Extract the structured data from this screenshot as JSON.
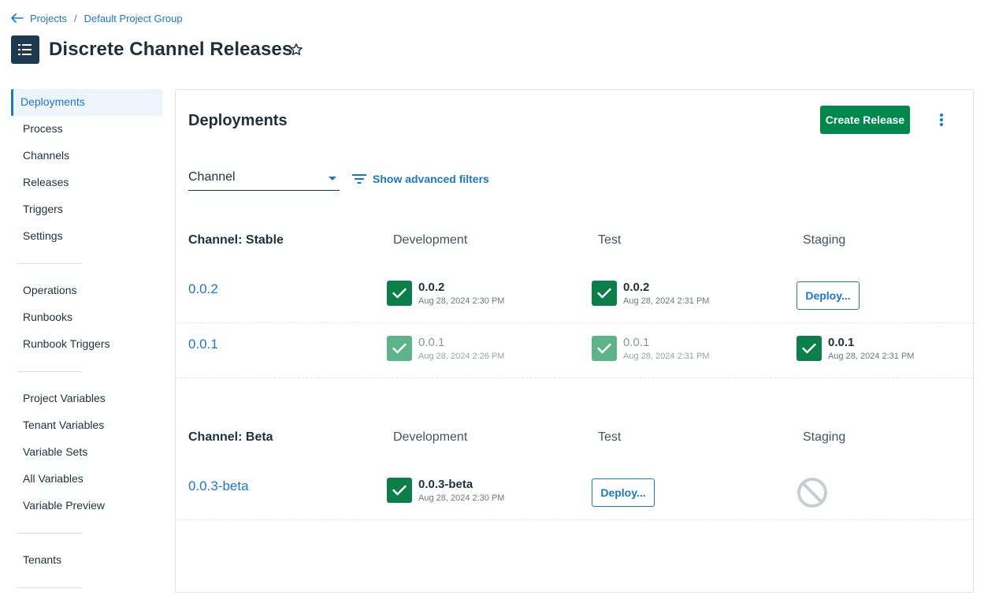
{
  "breadcrumb": {
    "projects_label": "Projects",
    "separator": "/",
    "group_label": "Default Project Group"
  },
  "header": {
    "title": "Discrete Channel Releases"
  },
  "sidebar": {
    "groups": [
      [
        "Deployments",
        "Process",
        "Channels",
        "Releases",
        "Triggers",
        "Settings"
      ],
      [
        "Operations",
        "Runbooks",
        "Runbook Triggers"
      ],
      [
        "Project Variables",
        "Tenant Variables",
        "Variable Sets",
        "All Variables",
        "Variable Preview"
      ],
      [
        "Tenants"
      ]
    ],
    "active": "Deployments"
  },
  "main": {
    "title": "Deployments",
    "create_release_label": "Create Release",
    "channel_filter_label": "Channel",
    "advanced_filters_label": "Show advanced filters",
    "channels": [
      {
        "name": "Channel: Stable",
        "environments": [
          "Development",
          "Test",
          "Staging"
        ],
        "releases": [
          {
            "version": "0.0.2",
            "cells": [
              {
                "type": "success",
                "version": "0.0.2",
                "date": "Aug 28, 2024 2:30 PM"
              },
              {
                "type": "success",
                "version": "0.0.2",
                "date": "Aug 28, 2024 2:31 PM"
              },
              {
                "type": "deploy",
                "label": "Deploy..."
              }
            ]
          },
          {
            "version": "0.0.1",
            "cells": [
              {
                "type": "success-faded",
                "version": "0.0.1",
                "date": "Aug 28, 2024 2:26 PM"
              },
              {
                "type": "success-faded",
                "version": "0.0.1",
                "date": "Aug 28, 2024 2:31 PM"
              },
              {
                "type": "success",
                "version": "0.0.1",
                "date": "Aug 28, 2024 2:31 PM"
              }
            ]
          }
        ]
      },
      {
        "name": "Channel: Beta",
        "environments": [
          "Development",
          "Test",
          "Staging"
        ],
        "releases": [
          {
            "version": "0.0.3-beta",
            "cells": [
              {
                "type": "success",
                "version": "0.0.3-beta",
                "date": "Aug 28, 2024 2:30 PM"
              },
              {
                "type": "deploy",
                "label": "Deploy..."
              },
              {
                "type": "blocked"
              }
            ]
          }
        ]
      }
    ]
  },
  "colors": {
    "accent": "#1a77ca",
    "success": "#0c7e4a",
    "success_faded": "#5eb48a",
    "primary_button": "#00874d",
    "logo_bg": "#1e3a52"
  },
  "icons": {
    "back": "arrow-left-icon",
    "star": "star-outline-icon",
    "more": "vertical-dots-icon",
    "filter": "filter-lines-icon",
    "check": "check-icon",
    "blocked": "no-entry-icon"
  }
}
